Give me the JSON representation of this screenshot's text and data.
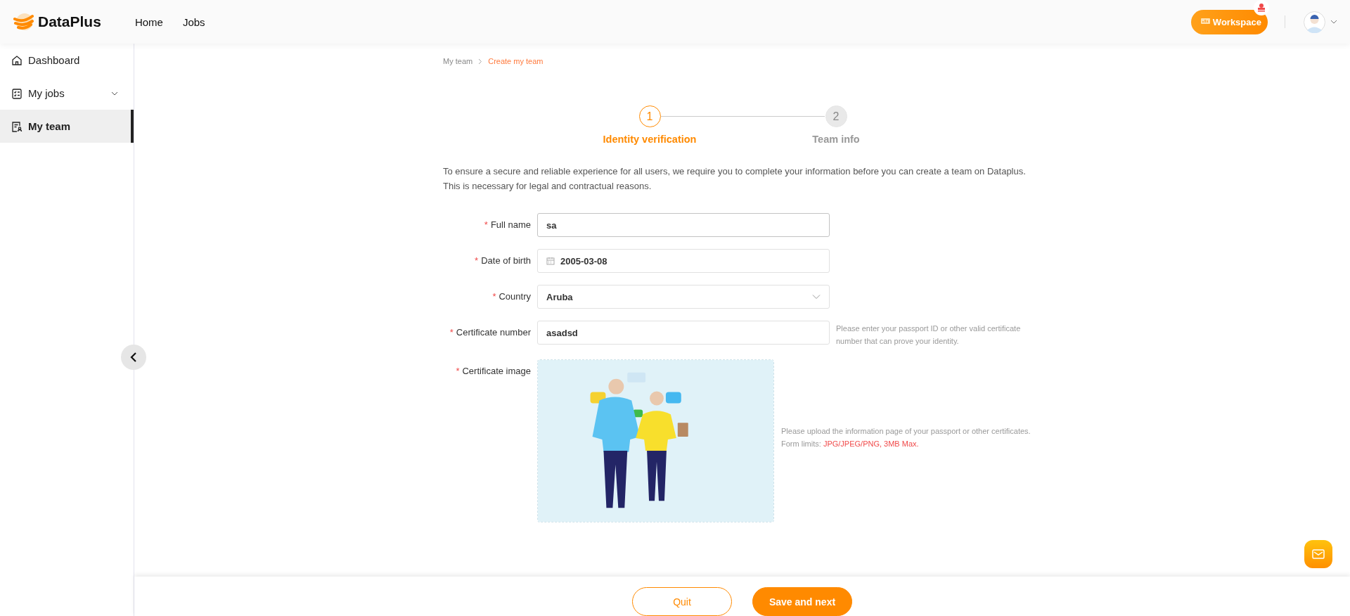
{
  "header": {
    "brand": "DataPlus",
    "nav": [
      {
        "label": "Home",
        "selected": false
      },
      {
        "label": "Jobs",
        "selected": false
      }
    ],
    "workspace_button": "Workspace"
  },
  "sidebar": {
    "items": [
      {
        "label": "Dashboard",
        "selected": false,
        "expandable_shown": false
      },
      {
        "label": "My jobs",
        "selected": false,
        "expandable_shown": true
      },
      {
        "label": "My team",
        "selected": true,
        "expandable_shown": false
      }
    ]
  },
  "breadcrumb": [
    {
      "label": "My team",
      "current": false
    },
    {
      "label": "Create my team",
      "current": true
    }
  ],
  "steps": [
    {
      "number": "1",
      "label": "Identity verification",
      "selected": true
    },
    {
      "number": "2",
      "label": "Team info",
      "selected": false
    }
  ],
  "intro": "To ensure a secure and reliable experience for all users, we require you to complete your information before you can create a team on Dataplus. This is necessary for legal and contractual reasons.",
  "form": {
    "fields": [
      {
        "kind": "text",
        "required_mark": "*",
        "label": "Full name",
        "value": "sa",
        "focused": true
      },
      {
        "kind": "date",
        "required_mark": "*",
        "label": "Date of birth",
        "value": "2005-03-08",
        "focused": false
      },
      {
        "kind": "select",
        "required_mark": "*",
        "label": "Country",
        "value": "Aruba",
        "focused": false
      },
      {
        "kind": "text",
        "required_mark": "*",
        "label": "Certificate number",
        "value": "asadsd",
        "focused": false,
        "hint": "Please enter your passport ID or other valid certificate number that can prove your identity."
      },
      {
        "required_mark": "*",
        "label": "Certificate image",
        "hint": "Please upload the information page of your passport or other certificates.",
        "limits_label": "Form limits:",
        "limits": "JPG/JPEG/PNG, 3MB Max."
      }
    ]
  },
  "footer": {
    "buttons": [
      {
        "label": "Quit",
        "kind": "secondary"
      },
      {
        "label": "Save and next",
        "kind": "primary"
      }
    ]
  }
}
